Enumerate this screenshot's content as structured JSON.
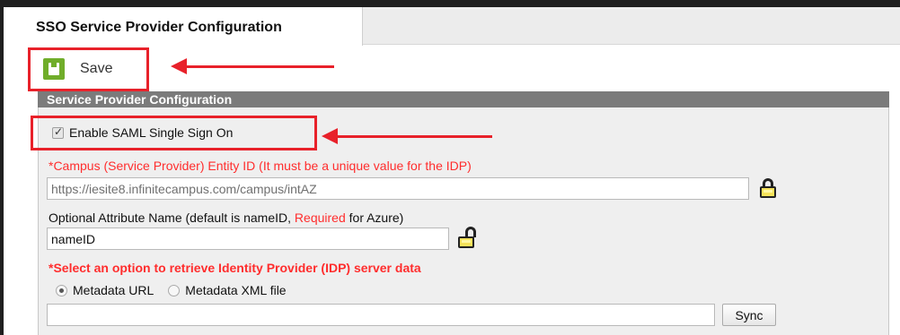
{
  "tab": {
    "title": "SSO Service Provider Configuration"
  },
  "toolbar": {
    "save_label": "Save"
  },
  "panel": {
    "header": "Service Provider Configuration"
  },
  "saml": {
    "enable_label": "Enable SAML Single Sign On",
    "enabled": true
  },
  "entity": {
    "label": "*Campus (Service Provider) Entity ID (It must be a unique value for the IDP)",
    "value": "https://iesite8.infinitecampus.com/campus/intAZ"
  },
  "attribute": {
    "label_prefix": "Optional Attribute Name (default is nameID, ",
    "label_required": "Required",
    "label_suffix": " for Azure)",
    "value": "nameID"
  },
  "idp": {
    "label": "*Select an option to retrieve Identity Provider (IDP) server data",
    "options": [
      "Metadata URL",
      "Metadata XML file"
    ],
    "selected": "Metadata URL",
    "url_value": ""
  },
  "sync_label": "Sync",
  "colors": {
    "highlight": "#e8212a",
    "save_icon": "#70ad2a",
    "required_text": "#ff2d2d",
    "panel_header": "#7b7b7b"
  },
  "icons": [
    "save-icon",
    "lock-icon",
    "unlock-icon",
    "arrow-icon"
  ]
}
